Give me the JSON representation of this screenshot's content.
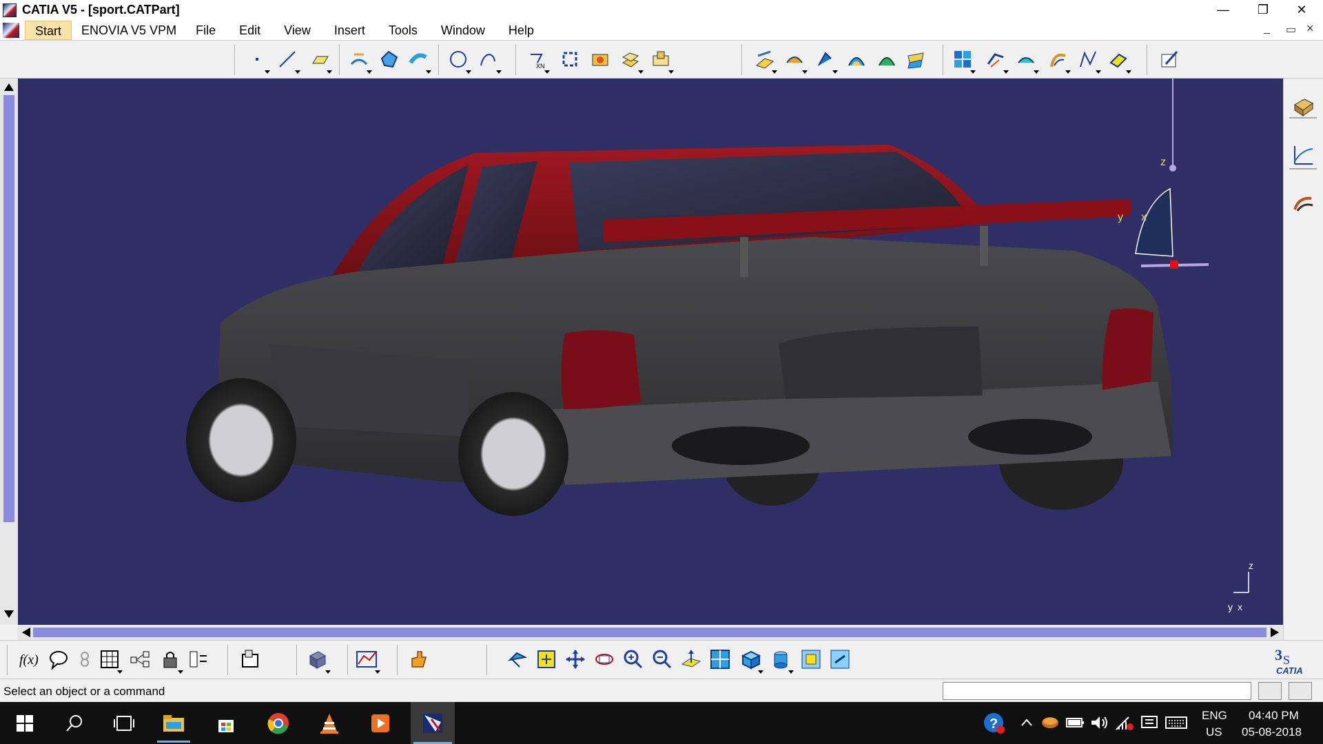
{
  "window": {
    "title": "CATIA V5 - [sport.CATPart]",
    "controls": [
      "—",
      "❐",
      "✕"
    ]
  },
  "menu": {
    "items": [
      {
        "label": "Start",
        "active": true
      },
      {
        "label": "ENOVIA V5 VPM"
      },
      {
        "label": "File"
      },
      {
        "label": "Edit"
      },
      {
        "label": "View"
      },
      {
        "label": "Insert"
      },
      {
        "label": "Tools"
      },
      {
        "label": "Window"
      },
      {
        "label": "Help"
      }
    ],
    "doc_controls": [
      "_",
      "▭",
      "×"
    ]
  },
  "toolbar_top": {
    "icons": [
      "point-icon",
      "line-icon",
      "plane-icon",
      "extrude-surface-icon",
      "fill-icon",
      "offset-icon",
      "circle-icon",
      "spline-icon",
      "project-icon",
      "join-icon",
      "sweep-icon",
      "multi-section-icon",
      "blend-icon",
      "intersect-icon",
      "split-icon",
      "trim-icon",
      "fillet-icon",
      "shape-fillet-icon",
      "translate-icon",
      "pattern-icon",
      "extrapolate-icon",
      "boundary-icon",
      "extract-icon",
      "near-icon",
      "axis-icon",
      "sketch-icon"
    ]
  },
  "viewport": {
    "background": "#2f2f66",
    "compass_axes": {
      "z": "z",
      "y": "y",
      "x": "x"
    },
    "mini_axes": {
      "z": "z",
      "y": "y",
      "x": "x"
    }
  },
  "toolbar_bottom": {
    "icons": [
      "formula-icon",
      "comment-icon",
      "knowledge-icon",
      "table-icon",
      "tree-icon",
      "lock-icon",
      "params-icon",
      "catalog-icon",
      "part-body-icon",
      "analysis-icon",
      "hand-icon",
      "fly-icon",
      "fit-all-icon",
      "pan-icon",
      "rotate-icon",
      "zoom-in-icon",
      "zoom-out-icon",
      "normal-view-icon",
      "multi-view-icon",
      "iso-view-icon",
      "shading-icon",
      "hide-show-icon",
      "swap-icon"
    ]
  },
  "statusbar": {
    "message": "Select an object or a command",
    "command_value": ""
  },
  "taskbar": {
    "language": "ENG",
    "region": "US",
    "time": "04:40 PM",
    "date": "05-08-2018"
  },
  "logo_text": "CATIA"
}
